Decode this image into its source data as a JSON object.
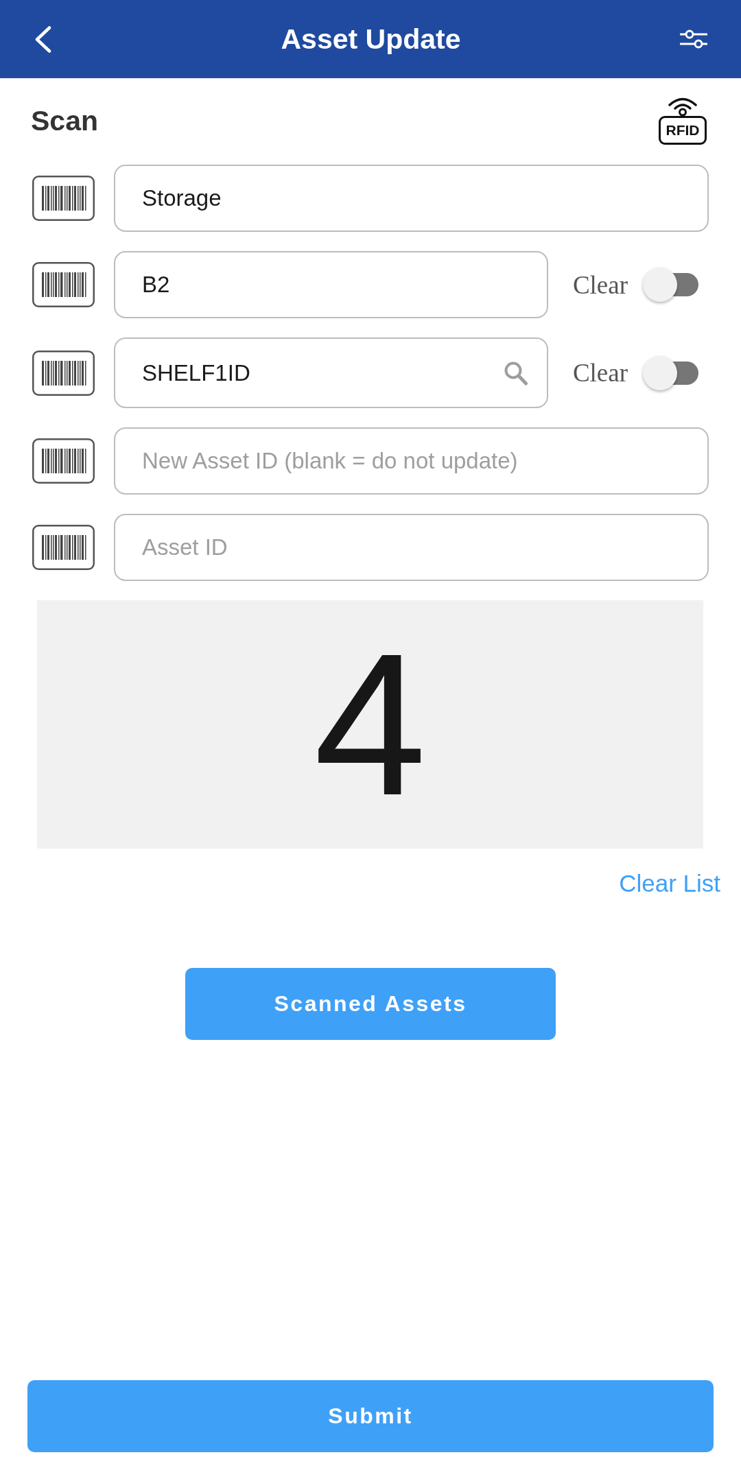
{
  "header": {
    "title": "Asset Update"
  },
  "scan": {
    "title": "Scan",
    "rfid_label": "RFID"
  },
  "fields": [
    {
      "kind": "text",
      "value": "Storage"
    },
    {
      "kind": "text",
      "value": "B2",
      "clear": {
        "label": "Clear",
        "on": false
      }
    },
    {
      "kind": "search",
      "value": "SHELF1ID",
      "clear": {
        "label": "Clear",
        "on": false
      }
    },
    {
      "kind": "text",
      "placeholder": "New Asset ID (blank = do not update)"
    },
    {
      "kind": "text",
      "placeholder": "Asset ID"
    }
  ],
  "count": "4",
  "clear_list": "Clear List",
  "buttons": {
    "scanned_assets": "Scanned Assets",
    "submit": "Submit"
  }
}
